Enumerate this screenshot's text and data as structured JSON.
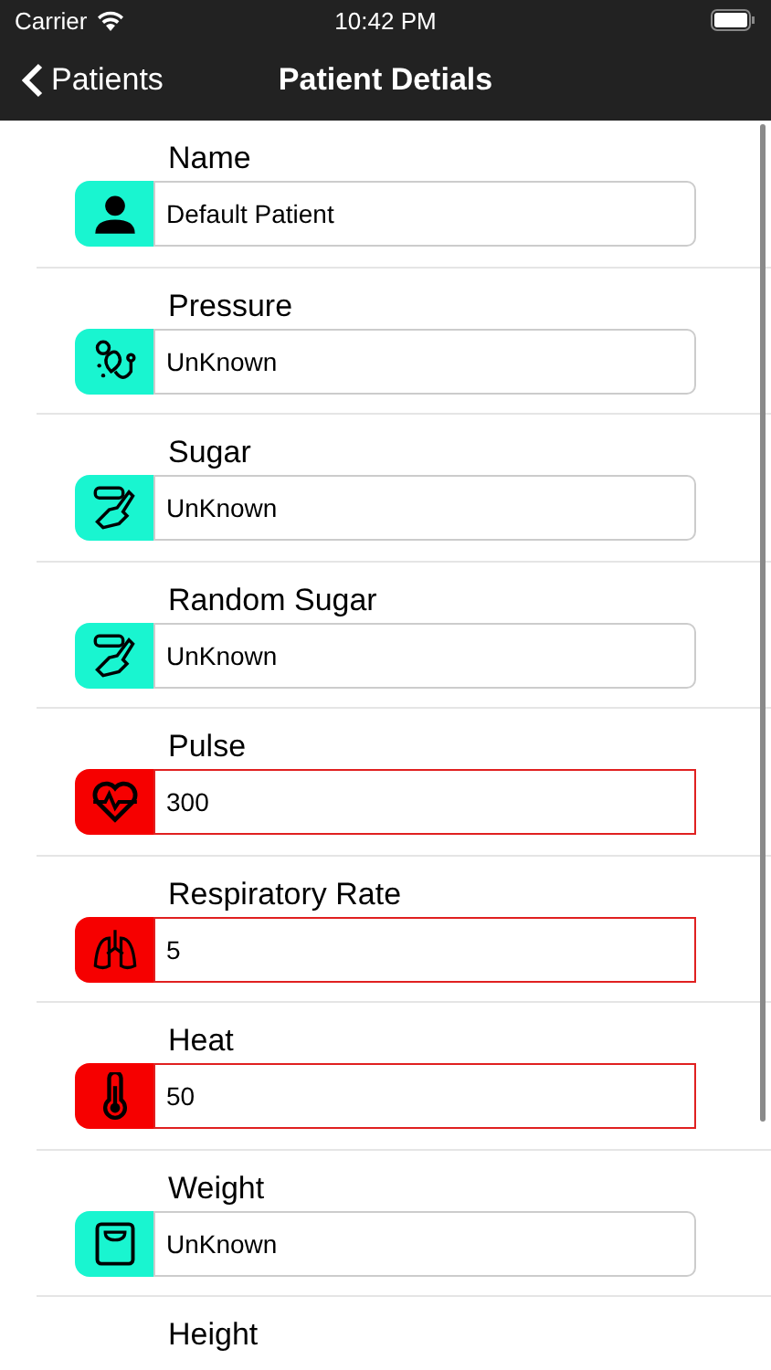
{
  "status_bar": {
    "carrier": "Carrier",
    "time": "10:42 PM"
  },
  "nav_bar": {
    "back": "Patients",
    "title": "Patient Detials"
  },
  "fields": [
    {
      "label": "Name",
      "kind": "person",
      "value": "Default Patient",
      "alert": false
    },
    {
      "label": "Pressure",
      "kind": "stethoscope",
      "value": "UnKnown",
      "alert": false
    },
    {
      "label": "Sugar",
      "kind": "glucometer",
      "value": "UnKnown",
      "alert": false
    },
    {
      "label": "Random Sugar",
      "kind": "glucometer",
      "value": "UnKnown",
      "alert": false
    },
    {
      "label": "Pulse",
      "kind": "heart",
      "value": "300",
      "alert": true
    },
    {
      "label": "Respiratory Rate",
      "kind": "lungs",
      "value": "5",
      "alert": true
    },
    {
      "label": "Heat",
      "kind": "thermometer",
      "value": "50",
      "alert": true
    },
    {
      "label": "Weight",
      "kind": "scale",
      "value": "UnKnown",
      "alert": false
    },
    {
      "label": "Height",
      "kind": "none"
    }
  ]
}
